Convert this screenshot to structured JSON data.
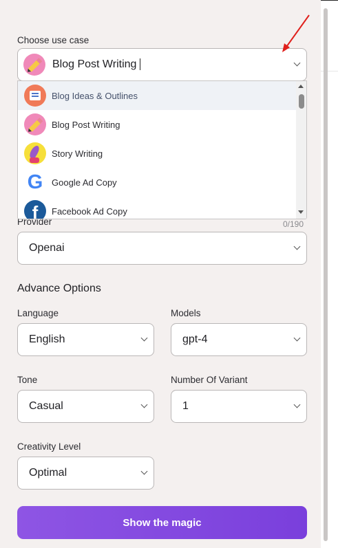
{
  "use_case": {
    "label": "Choose use case",
    "selected": "Blog Post Writing",
    "options": [
      {
        "label": "Blog Ideas & Outlines",
        "icon": "outline-doc-icon"
      },
      {
        "label": "Blog Post Writing",
        "icon": "pencil-icon"
      },
      {
        "label": "Story Writing",
        "icon": "quill-icon"
      },
      {
        "label": "Google Ad Copy",
        "icon": "google-icon"
      },
      {
        "label": "Facebook Ad Copy",
        "icon": "facebook-icon"
      }
    ]
  },
  "provider": {
    "label": "Provider",
    "counter": "0/190",
    "value": "Openai"
  },
  "advance": {
    "title": "Advance Options",
    "language_label": "Language",
    "language": "English",
    "models_label": "Models",
    "model": "gpt-4",
    "tone_label": "Tone",
    "tone": "Casual",
    "variant_label": "Number Of Variant",
    "variant": "1",
    "creativity_label": "Creativity Level",
    "creativity": "Optimal"
  },
  "submit_label": "Show the magic",
  "colors": {
    "accent": "#8e55e4",
    "annotation_arrow": "#e0201c",
    "panel_bg": "#f4f0ef"
  },
  "glyphs": {
    "google_letter": "G",
    "facebook_letter": "f"
  }
}
